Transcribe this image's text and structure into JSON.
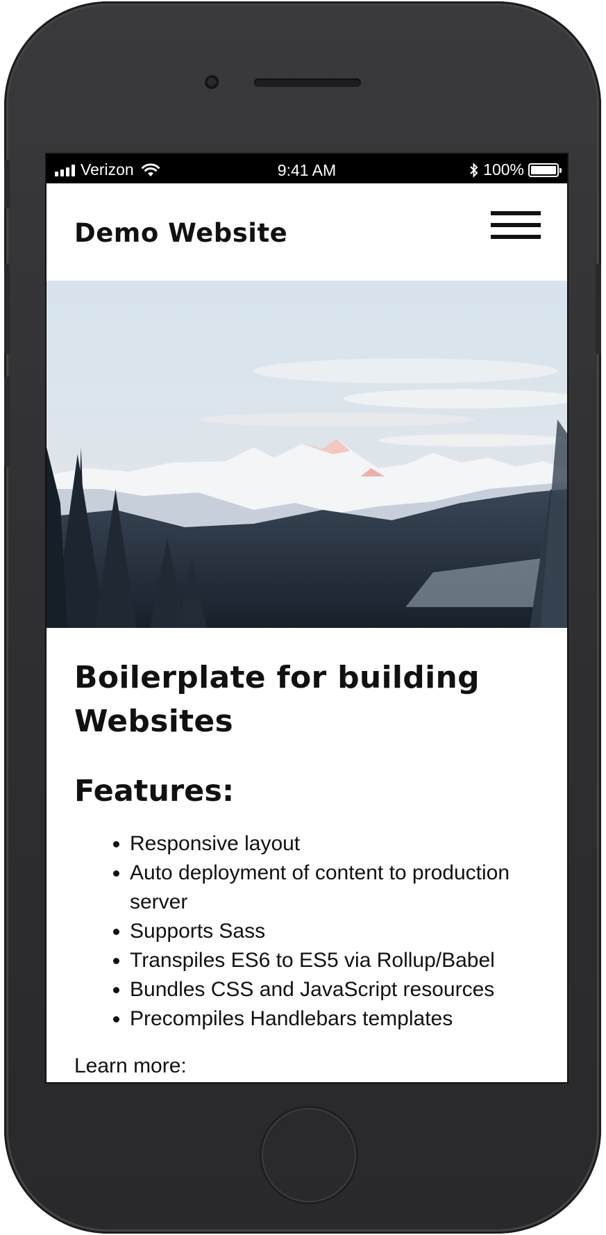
{
  "status_bar": {
    "carrier": "Verizon",
    "time": "9:41 AM",
    "battery_percent": "100%",
    "signal_icon": "signal-bars-icon",
    "wifi_icon": "wifi-icon",
    "bluetooth_icon": "bluetooth-icon",
    "battery_icon": "battery-icon",
    "battery_level": 1.0
  },
  "header": {
    "title": "Demo Website",
    "menu_icon": "hamburger-menu-icon"
  },
  "hero": {
    "image": "snowy-mountain-range"
  },
  "main": {
    "heading": "Boilerplate for building Websites",
    "features_heading": "Features:",
    "features": [
      "Responsive layout",
      "Auto deployment of content to production server",
      "Supports Sass",
      "Transpiles ES6 to ES5 via Rollup/Babel",
      "Bundles CSS and JavaScript resources",
      "Precompiles Handlebars templates"
    ],
    "learn_more": "Learn more:"
  },
  "colors": {
    "phone_body": "#2f2f31",
    "status_bar_bg": "#000000",
    "page_bg": "#ffffff",
    "text": "#111111"
  }
}
